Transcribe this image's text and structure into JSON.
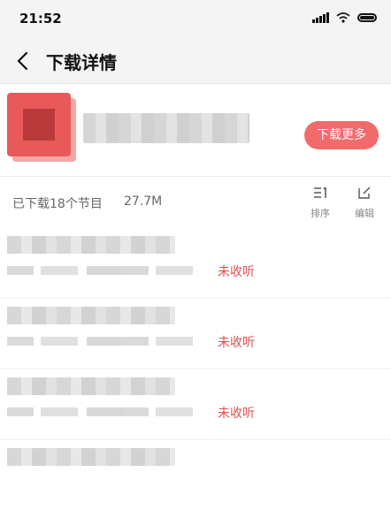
{
  "status_bar": {
    "time": "21:52"
  },
  "header": {
    "title": "下载详情"
  },
  "album": {
    "more_button": "下载更多"
  },
  "stats": {
    "count": "已下载18个节目",
    "size": "27.7M",
    "sort_label": "排序",
    "edit_label": "编辑"
  },
  "episodes": [
    {
      "status": "未收听"
    },
    {
      "status": "未收听"
    },
    {
      "status": "未收听"
    }
  ],
  "colors": {
    "accent": "#f26b6b",
    "status_text": "#e15050"
  }
}
